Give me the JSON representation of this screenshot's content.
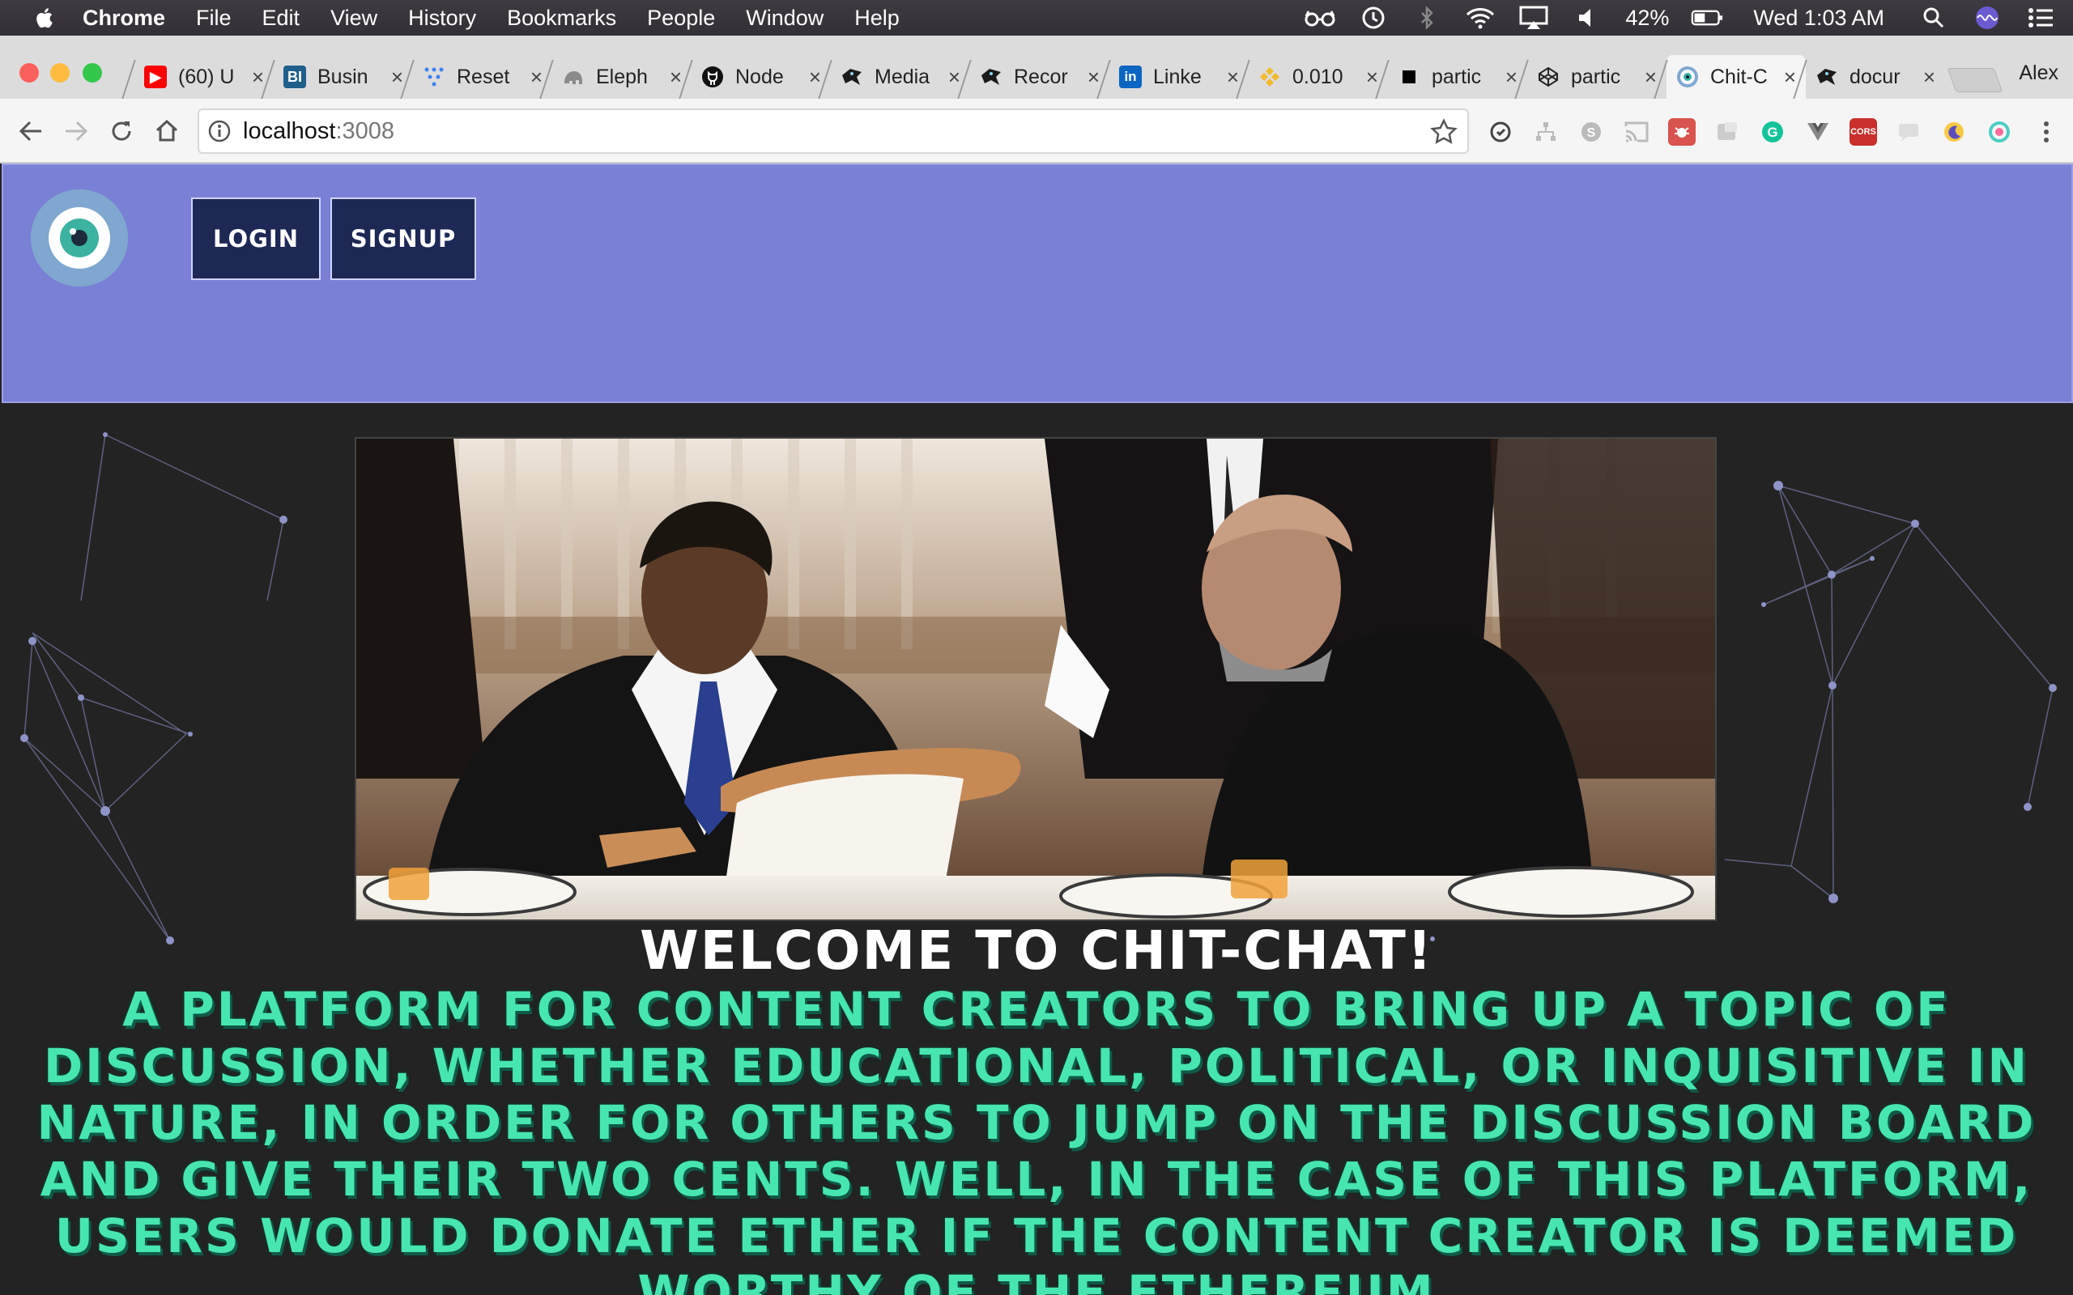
{
  "menubar": {
    "app_name": "Chrome",
    "items": [
      "File",
      "Edit",
      "View",
      "History",
      "Bookmarks",
      "People",
      "Window",
      "Help"
    ],
    "battery": "42%",
    "clock": "Wed 1:03 AM"
  },
  "tabs": [
    {
      "title": "(60) U",
      "icon": "youtube-icon",
      "color": "#ff0000"
    },
    {
      "title": "Busin",
      "icon": "business-insider-icon",
      "color": "#1f5f8b"
    },
    {
      "title": "Reset",
      "icon": "reset-dots-icon",
      "color": "#3b82f6"
    },
    {
      "title": "Eleph",
      "icon": "elephantsql-icon",
      "color": "#8a8a8a"
    },
    {
      "title": "Node",
      "icon": "github-icon",
      "color": "#111111"
    },
    {
      "title": "Media",
      "icon": "mdn-icon",
      "color": "#1b1b1b"
    },
    {
      "title": "Recor",
      "icon": "mdn-icon",
      "color": "#1b1b1b"
    },
    {
      "title": "Linke",
      "icon": "linkedin-icon",
      "color": "#0a66c2"
    },
    {
      "title": "0.010",
      "icon": "binance-icon",
      "color": "#f3ba2f"
    },
    {
      "title": "partic",
      "icon": "square-icon",
      "color": "#000000"
    },
    {
      "title": "partic",
      "icon": "codepen-icon",
      "color": "#222222"
    },
    {
      "title": "Chit-C",
      "icon": "chitchat-eye-icon",
      "color": "#3bb3a0",
      "active": true
    },
    {
      "title": "docur",
      "icon": "mdn-icon",
      "color": "#1b1b1b"
    }
  ],
  "profile_name": "Alex",
  "omnibox": {
    "host": "localhost",
    "port": ":3008"
  },
  "colors": {
    "header": "#7a80d6",
    "button": "#1d2855",
    "accent_text": "#47e6b1",
    "page_bg": "#232323"
  },
  "nav": {
    "login_label": "LOGIN",
    "signup_label": "SIGNUP"
  },
  "content": {
    "welcome": "WELCOME TO CHIT-CHAT!",
    "description": "A platform for content creators to bring up a topic of discussion, whether educational, political, or inquisitive in nature, in order for others to jump on the discussion board and give their two cents. Well, in the case of this platform, users would donate ether if the content creator is deemed worthy of the ethereum"
  }
}
